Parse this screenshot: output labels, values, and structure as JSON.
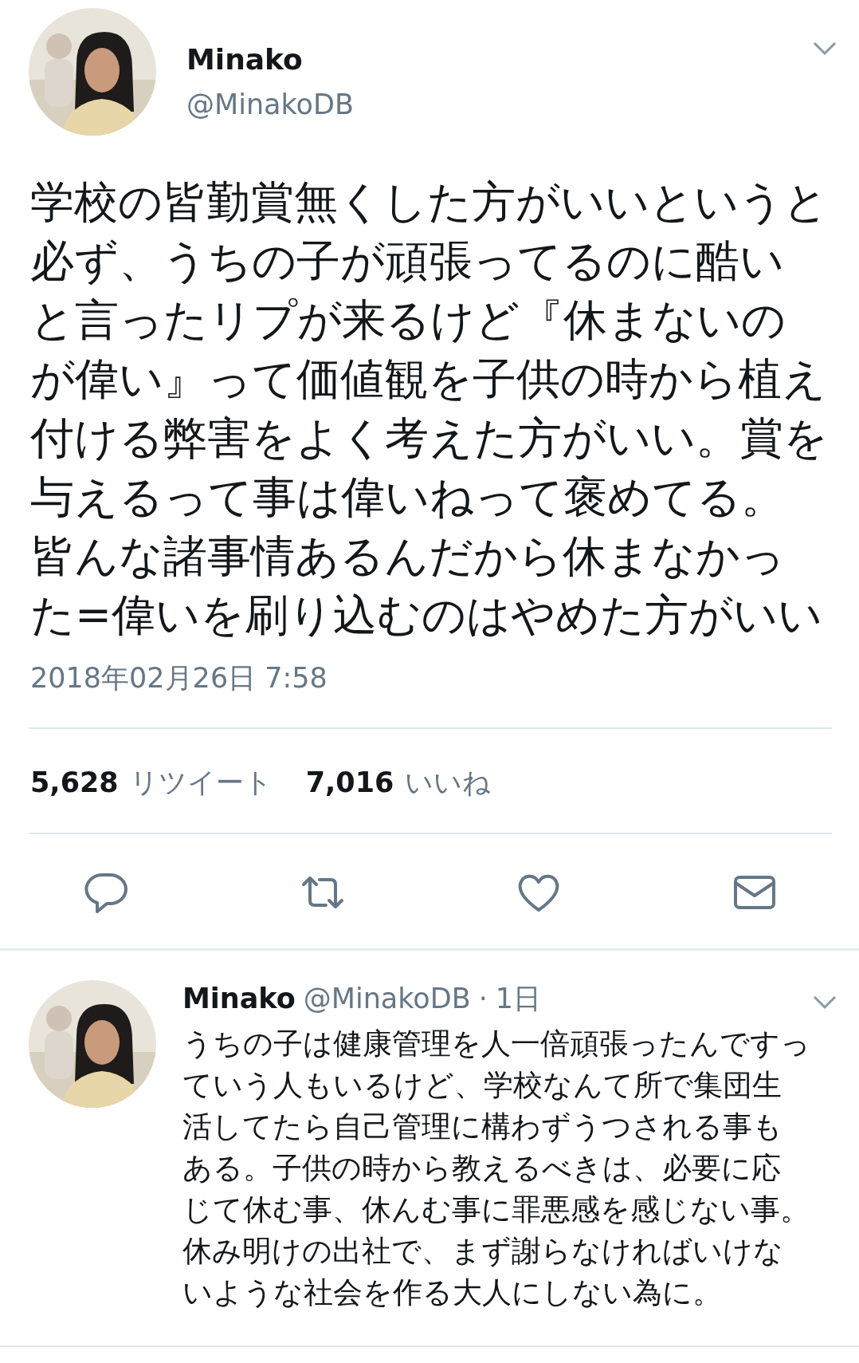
{
  "tweet": {
    "author": {
      "name": "Minako",
      "handle": "@MinakoDB"
    },
    "text": "学校の皆勤賞無くした方がいいというと必ず、うちの子が頑張ってるのに酷いと言ったリプが来るけど『休まないのが偉い』って価値観を子供の時から植え付ける弊害をよく考えた方がいい。賞を与えるって事は偉いねって褒めてる。皆んな諸事情あるんだから休まなかった=偉いを刷り込むのはやめた方がいい",
    "timestamp": "2018年02月26日 7:58",
    "stats": [
      {
        "count": "5,628",
        "label": "リツイート"
      },
      {
        "count": "7,016",
        "label": "いいね"
      }
    ],
    "actions": [
      {
        "kind": "reply"
      },
      {
        "kind": "retweet"
      },
      {
        "kind": "like"
      },
      {
        "kind": "message"
      }
    ]
  },
  "reply": {
    "author": {
      "name": "Minako",
      "handle": "@MinakoDB"
    },
    "separator": "·",
    "time": "1日",
    "text": "うちの子は健康管理を人一倍頑張ったんですっていう人もいるけど、学校なんて所で集団生活してたら自己管理に構わずうつされる事もある。子供の時から教えるべきは、必要に応じて休む事、休んむ事に罪悪感を感じない事。休み明けの出社で、まず謝らなければいけないような社会を作る大人にしない為に。"
  }
}
